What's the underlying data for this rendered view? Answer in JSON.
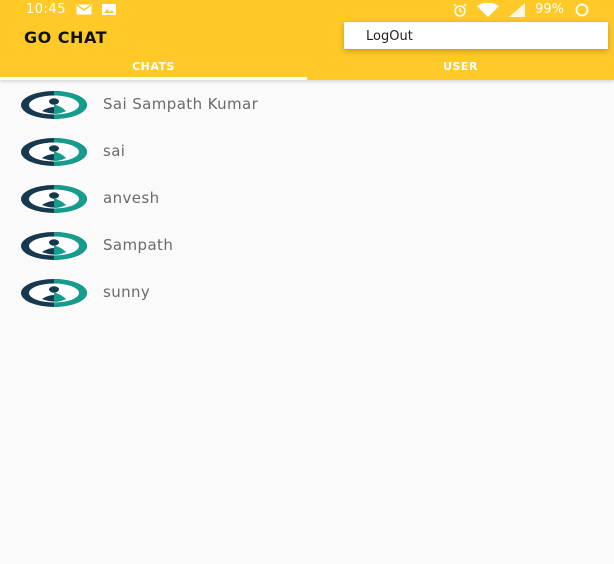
{
  "status_bar": {
    "time": "10:45",
    "battery_percent": "99%",
    "icons_left": [
      "mail-icon",
      "image-icon"
    ],
    "icons_right": [
      "alarm-icon",
      "wifi-icon",
      "signal-icon",
      "battery-icon"
    ]
  },
  "app_bar": {
    "title": "GO CHAT",
    "color": "#ffca28"
  },
  "tabs": [
    {
      "label": "CHATS",
      "active": true
    },
    {
      "label": "USER",
      "active": false
    }
  ],
  "overflow_menu": {
    "items": [
      {
        "label": "LogOut"
      }
    ]
  },
  "chats": [
    {
      "name": "Sai Sampath Kumar",
      "avatar": "user-avatar-icon"
    },
    {
      "name": "sai",
      "avatar": "user-avatar-icon"
    },
    {
      "name": "anvesh",
      "avatar": "user-avatar-icon"
    },
    {
      "name": "Sampath",
      "avatar": "user-avatar-icon"
    },
    {
      "name": "sunny",
      "avatar": "user-avatar-icon"
    }
  ],
  "colors": {
    "avatar_dark": "#17394f",
    "avatar_teal": "#159c8c",
    "text_gray": "#6a6a6a"
  }
}
